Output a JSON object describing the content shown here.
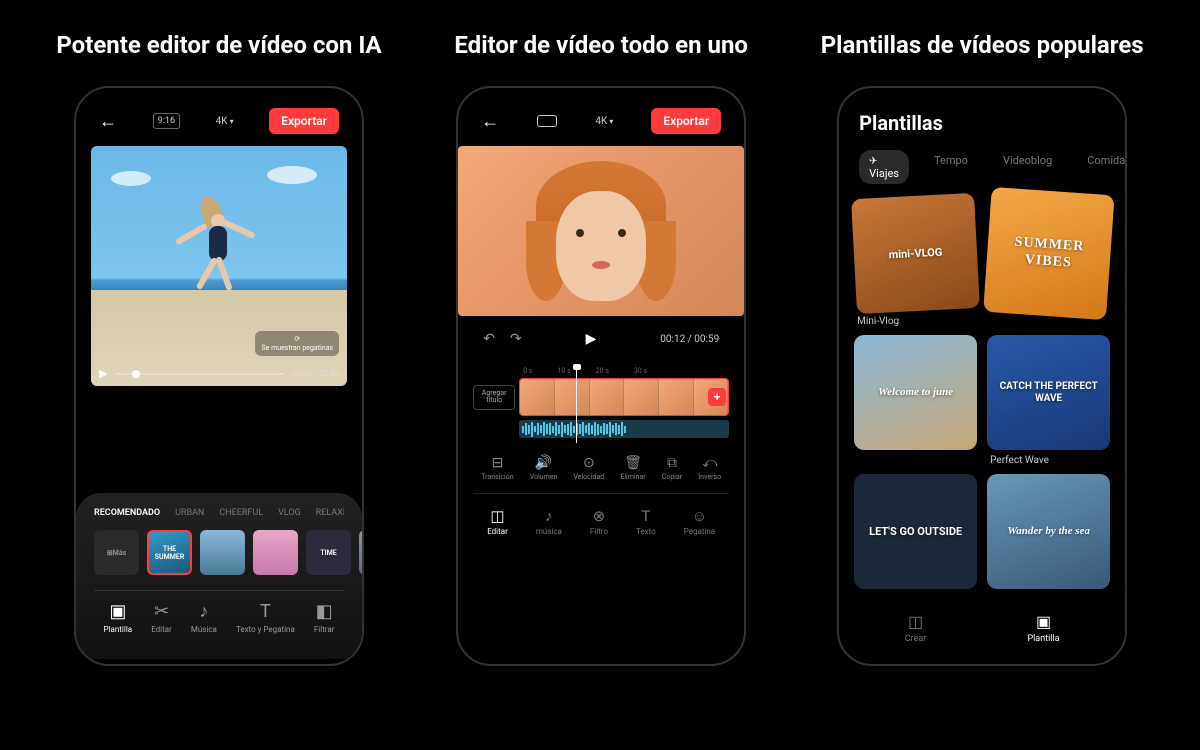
{
  "panels": {
    "p1": {
      "title": "Potente editor de vídeo con IA"
    },
    "p2": {
      "title": "Editor de vídeo todo en uno"
    },
    "p3": {
      "title": "Plantillas de vídeos populares"
    }
  },
  "phone1": {
    "ratio": "9:16",
    "resolution": "4K",
    "export": "Exportar",
    "time_current": "00:24",
    "time_total": "00:59",
    "sticker_badge": "Se muestran pegatinas",
    "tabs": [
      "RECOMENDADO",
      "URBAN",
      "CHEERFUL",
      "VLOG",
      "RELAXED"
    ],
    "more_label": "Más",
    "thumb_summer": "THE SUMMER",
    "thumb_time": "TIME",
    "tools": {
      "template": "Plantilla",
      "edit": "Editar",
      "music": "Música",
      "text": "Texto y Pegatina",
      "filter": "Filtrar"
    }
  },
  "phone2": {
    "resolution": "4K",
    "export": "Exportar",
    "time_current": "00:12",
    "time_total": "00:59",
    "ruler": [
      "0 s",
      "10 s",
      "20 s",
      "30 s"
    ],
    "add_title": "Agregar título",
    "actions": {
      "transition": "Transición",
      "volume": "Volumen",
      "speed": "Velocidad",
      "delete": "Eliminar",
      "copy": "Copiar",
      "reverse": "Inverso"
    },
    "nav": {
      "edit": "Editar",
      "music": "música",
      "filter": "Filtro",
      "text": "Texto",
      "sticker": "Pegatina"
    }
  },
  "phone3": {
    "header": "Plantillas",
    "tabs": {
      "travel": "Viajes",
      "tempo": "Tempo",
      "vlog": "Videoblog",
      "food": "Comida"
    },
    "cards": {
      "vlog": "mini-VLOG",
      "vlog_label": "Mini-Vlog",
      "summer": "SUMMER VIBES",
      "welcome": "Welcome to june",
      "wave": "CATCH THE PERFECT WAVE",
      "wave_label": "Perfect Wave",
      "outside": "LET'S GO OUTSIDE",
      "wander": "Wander by the sea"
    },
    "nav": {
      "create": "Crear",
      "template": "Plantilla"
    }
  }
}
